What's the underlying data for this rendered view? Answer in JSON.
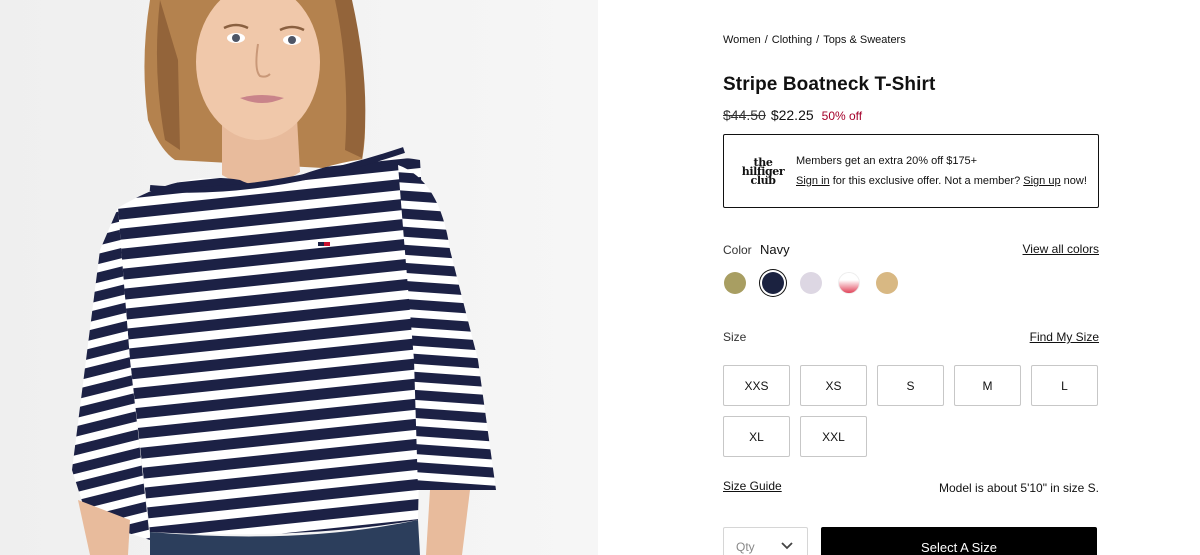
{
  "breadcrumb": [
    "Women",
    "Clothing",
    "Tops & Sweaters"
  ],
  "breadcrumb_separator": "/",
  "product": {
    "title": "Stripe Boatneck T-Shirt",
    "price_original": "$44.50",
    "price_sale": "$22.25",
    "discount": "50% off"
  },
  "promo": {
    "logo_lines": [
      "the",
      "hilfiger",
      "club"
    ],
    "headline": "Members get an extra 20% off $175+",
    "sign_in": "Sign in",
    "middle": "for this exclusive offer. Not a member?",
    "sign_up": "Sign up",
    "end": "now!"
  },
  "color": {
    "label": "Color",
    "selected": "Navy",
    "view_all": "View all colors",
    "swatches": [
      {
        "name": "olive",
        "color": "#a89e62"
      },
      {
        "name": "navy",
        "color": "#1b2240",
        "selected": true
      },
      {
        "name": "lavender",
        "color": "#ddd7e3"
      },
      {
        "name": "red-white",
        "color": "#e1445a"
      },
      {
        "name": "tan",
        "color": "#d8b883"
      }
    ]
  },
  "size": {
    "label": "Size",
    "find": "Find My Size",
    "options": [
      "XXS",
      "XS",
      "S",
      "M",
      "L",
      "XL",
      "XXL"
    ],
    "guide": "Size Guide",
    "model_note": "Model is about 5'10\" in size S."
  },
  "purchase": {
    "qty_placeholder": "Qty",
    "button": "Select A Size"
  },
  "colors": {
    "accent": "#a4002a",
    "stripe_navy": "#1c2145",
    "stripe_white": "#ffffff",
    "button_black": "#000000"
  }
}
